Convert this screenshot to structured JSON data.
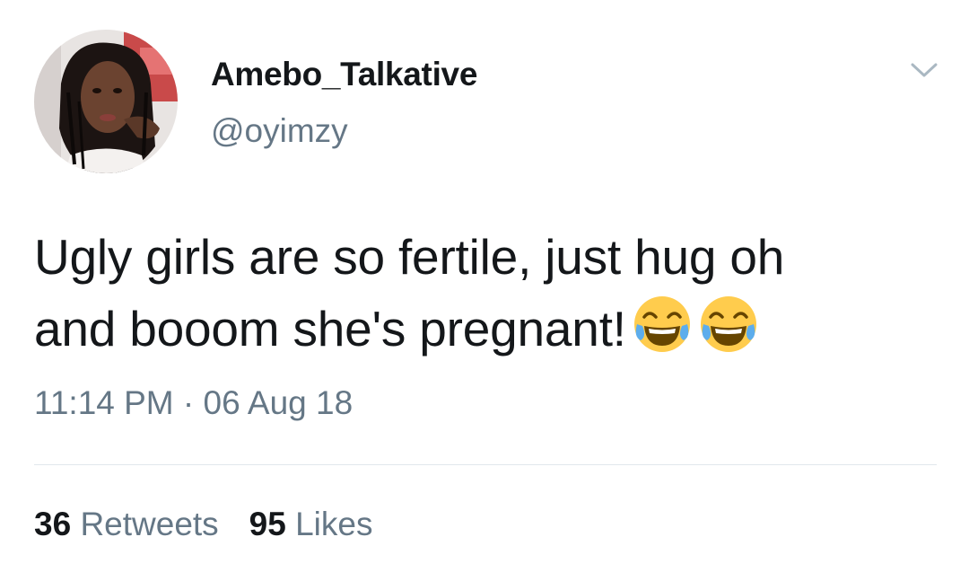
{
  "tweet": {
    "author": {
      "display_name": "Amebo_Talkative",
      "handle": "@oyimzy"
    },
    "text": {
      "line1": "Ugly girls are so fertile, just hug oh",
      "line2": "and booom she's pregnant!"
    },
    "emojis": [
      "face-with-tears-of-joy-icon",
      "face-with-tears-of-joy-icon"
    ],
    "timestamp": "11:14 PM · 06 Aug 18",
    "stats": {
      "retweets_count": "36",
      "retweets_label": "Retweets",
      "likes_count": "95",
      "likes_label": "Likes"
    }
  },
  "colors": {
    "text_primary": "#14171a",
    "text_secondary": "#657786",
    "divider": "#e1e8ed",
    "chevron": "#aab8c2"
  }
}
